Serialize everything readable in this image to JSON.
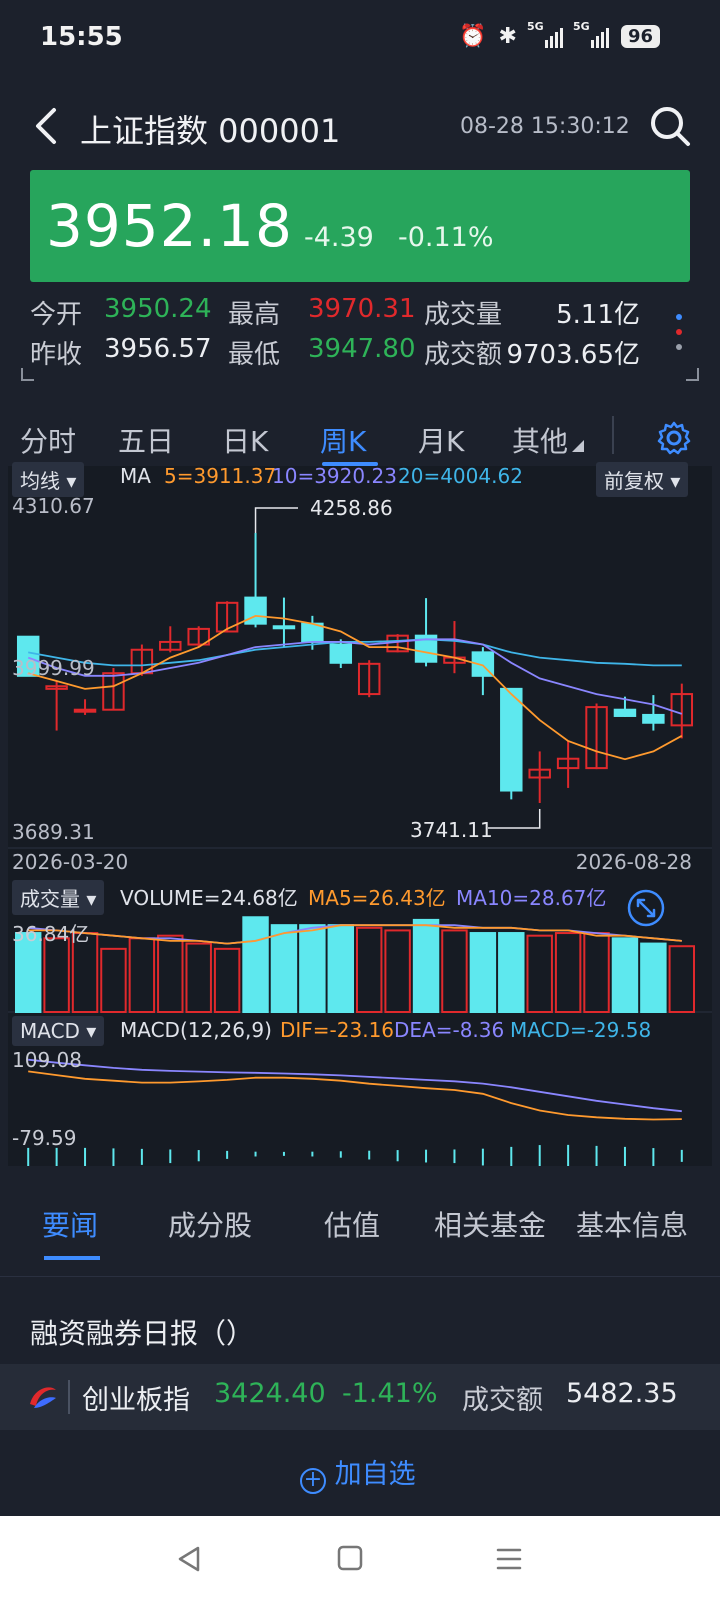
{
  "status_bar": {
    "time": "15:55",
    "battery": "96",
    "sig1": "5G",
    "sig2": "5G"
  },
  "header": {
    "title": "上证指数 000001",
    "datetime": "08-28 15:30:12"
  },
  "quote": {
    "price": "3952.18",
    "change": "-4.39",
    "change_pct": "-0.11%"
  },
  "stats": {
    "open_label": "今开",
    "open": "3950.24",
    "high_label": "最高",
    "high": "3970.31",
    "volume_label": "成交量",
    "volume": "5.11亿",
    "prev_close_label": "昨收",
    "prev_close": "3956.57",
    "low_label": "最低",
    "low": "3947.80",
    "amount_label": "成交额",
    "amount": "9703.65亿"
  },
  "period_tabs": [
    "分时",
    "五日",
    "日K",
    "周K",
    "月K",
    "其他"
  ],
  "active_period": "周K",
  "kline": {
    "indicator_select": "均线",
    "ma_label": "MA",
    "ma5": "5=3911.37",
    "ma10": "10=3920.23",
    "ma20": "20=4004.62",
    "adjust_select": "前复权",
    "y_top": "4310.67",
    "y_mid": "3999.99",
    "y_bottom": "3689.31",
    "max_label": "4258.86",
    "min_label": "3741.11",
    "date_start": "2026-03-20",
    "date_end": "2026-08-28"
  },
  "volume_panel": {
    "select": "成交量",
    "volume": "VOLUME=24.68亿",
    "ma5": "MA5=26.43亿",
    "ma10": "MA10=28.67亿",
    "y_top": "36.84亿"
  },
  "macd_panel": {
    "select": "MACD",
    "params": "MACD(12,26,9)",
    "dif": "DIF=-23.16",
    "dea": "DEA=-8.36",
    "macd": "MACD=-29.58",
    "y_top": "109.08",
    "y_bottom": "-79.59"
  },
  "info_tabs": [
    "要闻",
    "成分股",
    "估值",
    "相关基金",
    "基本信息"
  ],
  "active_info_tab": "要闻",
  "news_title": "融资融券日报（）",
  "ticker": {
    "name": "创业板指",
    "price": "3424.40",
    "pct": "-1.41%",
    "amount_label": "成交额",
    "amount": "5482.35"
  },
  "add_watchlist": "加自选",
  "colors": {
    "up": "#e0292c",
    "down": "#5ee8ee",
    "green": "#27a55c",
    "accent": "#3e8cff",
    "ma5": "#ff9a2e",
    "ma10": "#8a86ff",
    "ma20": "#3fb5e8"
  },
  "chart_data": {
    "type": "candlestick",
    "title": "",
    "ylim": [
      3689.31,
      4310.67
    ],
    "dates": [
      "2026-03-20",
      "2026-08-28"
    ],
    "candles": [
      {
        "o": 4060,
        "c": 3985,
        "h": 4060,
        "l": 3985
      },
      {
        "o": 3960,
        "c": 3965,
        "h": 3975,
        "l": 3880
      },
      {
        "o": 3920,
        "c": 3920,
        "h": 3940,
        "l": 3910
      },
      {
        "o": 3920,
        "c": 3990,
        "h": 4000,
        "l": 3920
      },
      {
        "o": 3990,
        "c": 4035,
        "h": 4045,
        "l": 3985
      },
      {
        "o": 4035,
        "c": 4050,
        "h": 4080,
        "l": 4030
      },
      {
        "o": 4045,
        "c": 4075,
        "h": 4080,
        "l": 4040
      },
      {
        "o": 4070,
        "c": 4125,
        "h": 4128,
        "l": 4068
      },
      {
        "o": 4135,
        "c": 4085,
        "h": 4258.86,
        "l": 4078
      },
      {
        "o": 4080,
        "c": 4078,
        "h": 4135,
        "l": 4040
      },
      {
        "o": 4085,
        "c": 4050,
        "h": 4100,
        "l": 4035
      },
      {
        "o": 4045,
        "c": 4010,
        "h": 4055,
        "l": 4000
      },
      {
        "o": 3950,
        "c": 4008,
        "h": 4015,
        "l": 3944
      },
      {
        "o": 4032,
        "c": 4062,
        "h": 4065,
        "l": 4030
      },
      {
        "o": 4062,
        "c": 4012,
        "h": 4134,
        "l": 4003
      },
      {
        "o": 4010,
        "c": 4020,
        "h": 4090,
        "l": 3990
      },
      {
        "o": 4030,
        "c": 3985,
        "h": 4040,
        "l": 3948
      },
      {
        "o": 3960,
        "c": 3765,
        "h": 3960,
        "l": 3748
      },
      {
        "o": 3790,
        "c": 3805,
        "h": 3840,
        "l": 3741.11
      },
      {
        "o": 3808,
        "c": 3826,
        "h": 3860,
        "l": 3770
      },
      {
        "o": 3808,
        "c": 3925,
        "h": 3932,
        "l": 3806
      },
      {
        "o": 3920,
        "c": 3908,
        "h": 3945,
        "l": 3906
      },
      {
        "o": 3910,
        "c": 3895,
        "h": 3948,
        "l": 3880
      },
      {
        "o": 3890,
        "c": 3950,
        "h": 3970,
        "l": 3865
      }
    ],
    "ma5": [
      3990,
      3975,
      3960,
      3965,
      3990,
      4020,
      4040,
      4075,
      4100,
      4095,
      4085,
      4070,
      4040,
      4040,
      4030,
      4020,
      4005,
      3950,
      3900,
      3860,
      3840,
      3825,
      3840,
      3870
    ],
    "ma10": [
      4020,
      4000,
      3985,
      3985,
      3990,
      4000,
      4010,
      4025,
      4040,
      4045,
      4050,
      4050,
      4045,
      4050,
      4055,
      4055,
      4045,
      4010,
      3980,
      3965,
      3950,
      3940,
      3930,
      3912
    ],
    "ma20": [
      4030,
      4020,
      4010,
      4005,
      4005,
      4010,
      4015,
      4025,
      4035,
      4040,
      4045,
      4050,
      4050,
      4052,
      4055,
      4052,
      4045,
      4030,
      4020,
      4015,
      4010,
      4008,
      4005,
      4005
    ],
    "volumes": [
      30,
      28,
      30,
      24,
      28,
      29,
      26,
      24,
      36,
      33,
      33,
      33,
      32,
      31,
      35,
      31,
      30,
      30,
      29,
      30,
      30,
      28,
      26,
      25
    ],
    "vol_ma": [
      32,
      31,
      30,
      29,
      28,
      28,
      27,
      26,
      27,
      30,
      32,
      33,
      33,
      33,
      33,
      33,
      32,
      32,
      31,
      31,
      30,
      29,
      28,
      27
    ],
    "vol_ylim": [
      0,
      38
    ],
    "dif": [
      105,
      95,
      85,
      80,
      75,
      75,
      78,
      82,
      88,
      88,
      85,
      80,
      72,
      66,
      60,
      55,
      45,
      20,
      0,
      -12,
      -18,
      -22,
      -24,
      -23
    ],
    "dea": [
      130,
      122,
      115,
      108,
      103,
      100,
      98,
      96,
      95,
      93,
      91,
      88,
      84,
      80,
      76,
      72,
      66,
      56,
      44,
      32,
      20,
      10,
      0,
      -8
    ],
    "macd_hist": [
      -50,
      -50,
      -50,
      -45,
      -40,
      -34,
      -28,
      -20,
      -12,
      -10,
      -12,
      -16,
      -22,
      -28,
      -32,
      -34,
      -42,
      -60,
      -78,
      -80,
      -70,
      -60,
      -48,
      -30
    ],
    "macd_ylim": [
      -79.59,
      109.08
    ]
  }
}
